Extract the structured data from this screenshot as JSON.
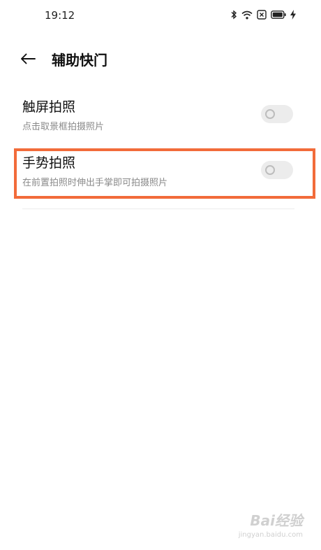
{
  "status_bar": {
    "time": "19:12",
    "icons": [
      "bluetooth-icon",
      "wifi-icon",
      "sim-icon",
      "battery-icon",
      "charging-icon"
    ]
  },
  "header": {
    "title": "辅助快门"
  },
  "settings": [
    {
      "title": "触屏拍照",
      "subtitle": "点击取景框拍摄照片",
      "enabled": false
    },
    {
      "title": "手势拍照",
      "subtitle": "在前置拍照时伸出手掌即可拍摄照片",
      "enabled": false
    }
  ],
  "annotation": {
    "highlight_color": "#f26b3a"
  },
  "watermark": {
    "main": "Bai经验",
    "sub": "jingyan.baidu.com"
  }
}
